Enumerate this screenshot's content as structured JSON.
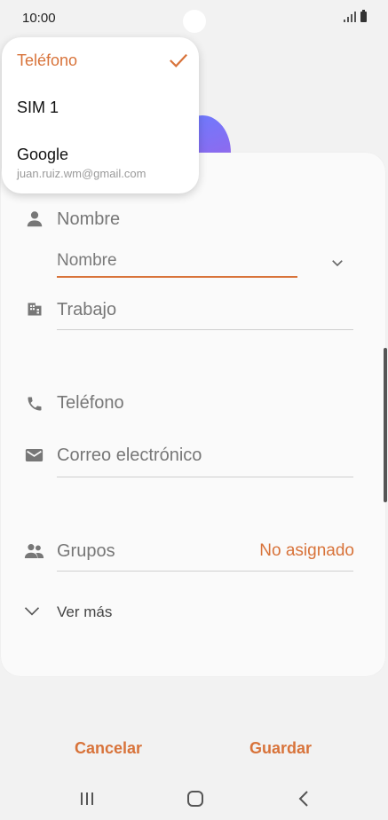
{
  "status": {
    "time": "10:00"
  },
  "account_menu": {
    "items": [
      {
        "label": "Teléfono",
        "selected": true
      },
      {
        "label": "SIM 1"
      },
      {
        "label": "Google",
        "sublabel": "juan.ruiz.wm@gmail.com"
      }
    ]
  },
  "form": {
    "name_label": "Nombre",
    "name_field_placeholder": "Nombre",
    "work_label": "Trabajo",
    "phone_label": "Teléfono",
    "email_label": "Correo electrónico",
    "groups_label": "Grupos",
    "groups_value": "No asignado",
    "see_more": "Ver más"
  },
  "actions": {
    "cancel": "Cancelar",
    "save": "Guardar"
  },
  "colors": {
    "accent": "#d8733a",
    "avatar": "#7b74ff"
  },
  "icons": [
    "person-icon",
    "building-icon",
    "phone-icon",
    "email-icon",
    "group-icon",
    "chevron-down-icon",
    "check-icon"
  ]
}
